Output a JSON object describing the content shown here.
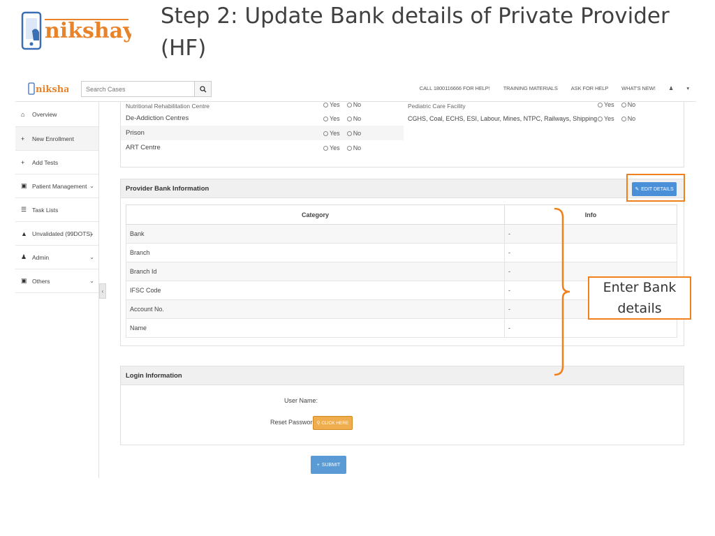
{
  "slide": {
    "title": "Step 2: Update Bank details of Private Provider (HF)",
    "logo_text": "nikshay",
    "callout": "Enter Bank details"
  },
  "header": {
    "logo_text": "nikshay",
    "search_placeholder": "Search Cases",
    "nav": [
      "CALL 1800116666 FOR HELP!",
      "TRAINING MATERIALS",
      "ASK FOR HELP",
      "WHAT'S NEW!"
    ]
  },
  "sidebar": {
    "items": [
      {
        "label": "Overview",
        "icon": "home-icon",
        "chevron": false
      },
      {
        "label": "New Enrollment",
        "icon": "plus-icon",
        "chevron": false
      },
      {
        "label": "Add Tests",
        "icon": "plus-icon",
        "chevron": false
      },
      {
        "label": "Patient Management",
        "icon": "briefcase-icon",
        "chevron": true
      },
      {
        "label": "Task Lists",
        "icon": "list-icon",
        "chevron": false
      },
      {
        "label": "Unvalidated (99DOTS)",
        "icon": "warning-icon",
        "chevron": true
      },
      {
        "label": "Admin",
        "icon": "user-icon",
        "chevron": true
      },
      {
        "label": "Others",
        "icon": "briefcase-icon",
        "chevron": true
      }
    ]
  },
  "facilities": {
    "left": [
      {
        "label": "Nutritional Rehabilitation Centre"
      },
      {
        "label": "De-Addiction Centres"
      },
      {
        "label": "Prison"
      },
      {
        "label": "ART Centre"
      }
    ],
    "right": [
      {
        "label": "Pediatric Care Facility"
      },
      {
        "label": "CGHS, Coal, ECHS, ESI, Labour, Mines, NTPC, Railways, Shipping"
      }
    ],
    "yes_label": "Yes",
    "no_label": "No"
  },
  "bank_section": {
    "title": "Provider Bank Information",
    "edit_button": "EDIT DETAILS",
    "headers": {
      "category": "Category",
      "info": "Info"
    },
    "rows": [
      {
        "category": "Bank",
        "info": "-"
      },
      {
        "category": "Branch",
        "info": "-"
      },
      {
        "category": "Branch Id",
        "info": "-"
      },
      {
        "category": "IFSC Code",
        "info": "-"
      },
      {
        "category": "Account No.",
        "info": "-"
      },
      {
        "category": "Name",
        "info": "-"
      }
    ]
  },
  "login_section": {
    "title": "Login Information",
    "username_label": "User Name:",
    "reset_label": "Reset Password:",
    "click_button": "CLICK HERE"
  },
  "submit_button": "SUBMIT",
  "colors": {
    "accent": "#4a90d9",
    "highlight": "#f0801c",
    "warning": "#f0ad4e",
    "logo_orange": "#e8832a"
  }
}
